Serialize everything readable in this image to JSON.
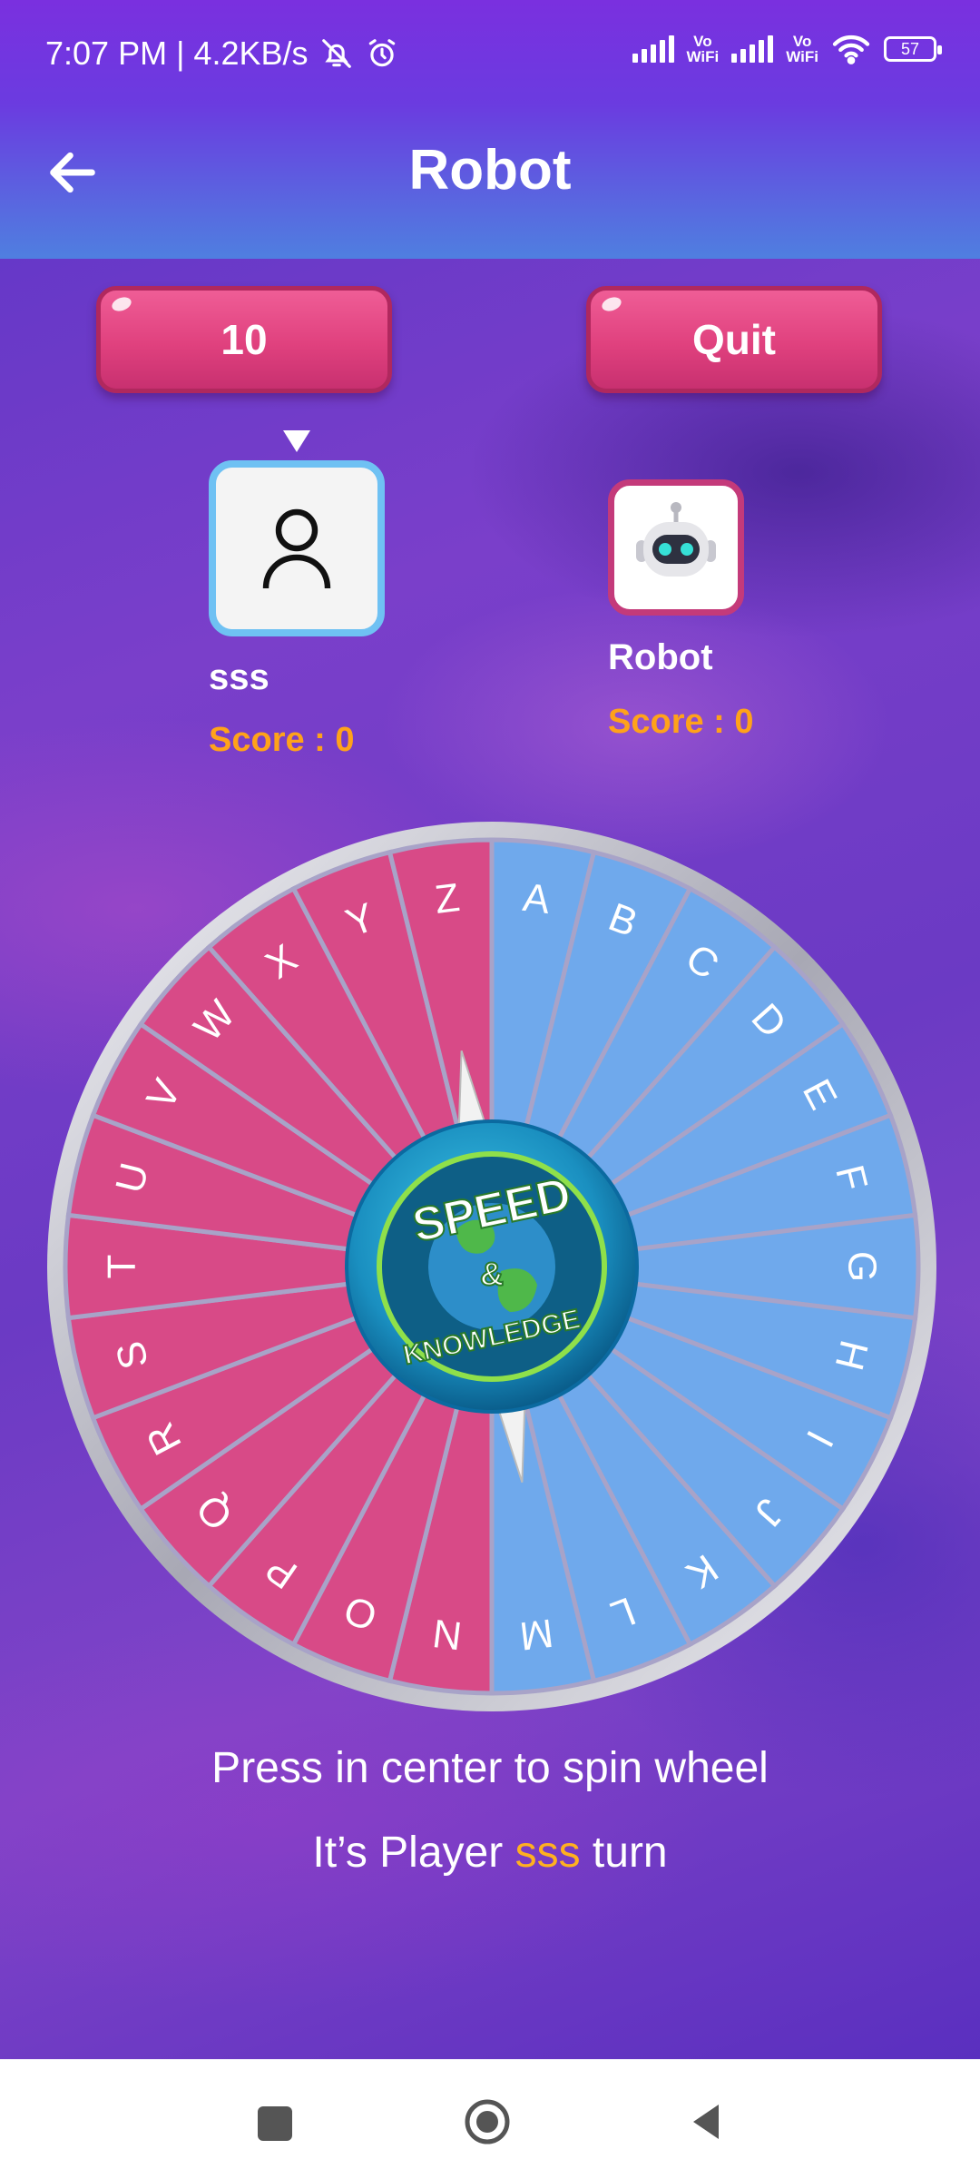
{
  "status_bar": {
    "time_speed": "7:07 PM | 4.2KB/s",
    "wifi_label_1": "Vo\nWiFi",
    "wifi_label_2": "Vo\nWiFi",
    "battery": "57"
  },
  "app_bar": {
    "title": "Robot"
  },
  "buttons": {
    "count_label": "10",
    "quit_label": "Quit"
  },
  "players": [
    {
      "name": "sss",
      "score": "Score : 0",
      "active": true,
      "icon": "person-outline-icon"
    },
    {
      "name": "Robot",
      "score": "Score : 0",
      "active": false,
      "icon": "robot-icon"
    }
  ],
  "wheel": {
    "letters": [
      "A",
      "B",
      "C",
      "D",
      "E",
      "F",
      "G",
      "H",
      "I",
      "J",
      "K",
      "L",
      "M",
      "N",
      "O",
      "P",
      "Q",
      "R",
      "S",
      "T",
      "U",
      "V",
      "W",
      "X",
      "Y",
      "Z"
    ],
    "colors": {
      "blue_half": "#6fa9ec",
      "pink_half": "#d84a87",
      "rim": "#c8c8d0",
      "divider": "#a8a3c8"
    },
    "center_logo": {
      "line1": "SPEED",
      "line2": "&",
      "line3": "KNOWLEDGE"
    }
  },
  "hints": {
    "spin": "Press in center to spin wheel",
    "turn_prefix": "It’s Player",
    "turn_player": "sss",
    "turn_suffix": "turn"
  },
  "colors": {
    "accent_pink": "#e0417e",
    "score_orange": "#ffa21a",
    "header_blue": "#4f7fe0",
    "header_purple": "#7a30df"
  }
}
